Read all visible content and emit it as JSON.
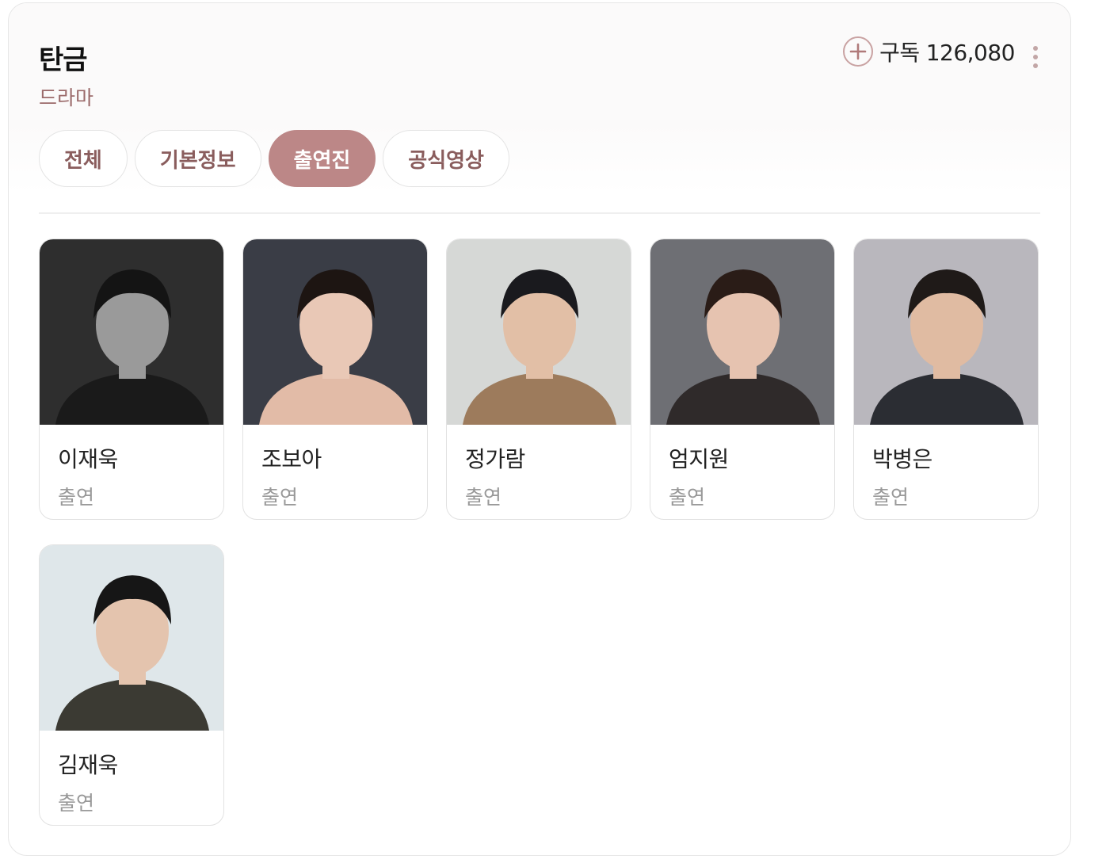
{
  "header": {
    "title": "탄금",
    "subtitle": "드라마",
    "subscribe_label": "구독",
    "subscribe_count": "126,080"
  },
  "tabs": [
    {
      "label": "전체",
      "active": false
    },
    {
      "label": "기본정보",
      "active": false
    },
    {
      "label": "출연진",
      "active": true
    },
    {
      "label": "공식영상",
      "active": false
    }
  ],
  "cast": [
    {
      "name": "이재욱",
      "role": "출연",
      "bg": "#2e2e2e",
      "tone": "#9a9a9a",
      "hair": "#141414",
      "cloth": "#1a1a1a"
    },
    {
      "name": "조보아",
      "role": "출연",
      "bg": "#3a3d46",
      "tone": "#e9c8b6",
      "hair": "#1d1512",
      "cloth": "#e2bba7"
    },
    {
      "name": "정가람",
      "role": "출연",
      "bg": "#d6d8d6",
      "tone": "#e2bfa6",
      "hair": "#1a1a1e",
      "cloth": "#9d7b5c"
    },
    {
      "name": "엄지원",
      "role": "출연",
      "bg": "#6e6f74",
      "tone": "#e6c3b0",
      "hair": "#2a1c17",
      "cloth": "#2f2a2a"
    },
    {
      "name": "박병은",
      "role": "출연",
      "bg": "#b9b7bd",
      "tone": "#e0bba2",
      "hair": "#1f1a18",
      "cloth": "#2b2d33"
    },
    {
      "name": "김재욱",
      "role": "출연",
      "bg": "#dfe7ea",
      "tone": "#e4c4ae",
      "hair": "#161616",
      "cloth": "#3b3a33"
    }
  ],
  "colors": {
    "accent": "#bc8787",
    "accent_text": "#8a5d5d",
    "subtitle": "#9b6a6a"
  },
  "icons": {
    "subscribe": "plus-circle-icon",
    "more": "more-vertical-icon"
  }
}
